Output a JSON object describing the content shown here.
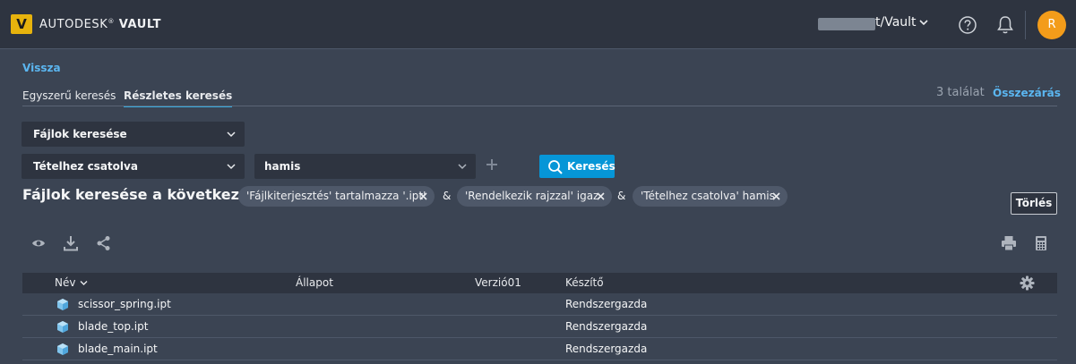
{
  "app": {
    "logo_letter": "V",
    "brand_prefix": "AUTODESK",
    "brand_product": "VAULT",
    "vault_name": "t/Vault",
    "user_initial": "R"
  },
  "nav": {
    "back_label": "Vissza"
  },
  "tabs": [
    {
      "label": "Egyszerű keresés",
      "active": false
    },
    {
      "label": "Részletes keresés",
      "active": true
    }
  ],
  "results": {
    "count_text": "3 találat",
    "collapse_label": "Összezárás"
  },
  "search": {
    "search_type": "Fájlok keresése",
    "property": "Tételhez csatolva",
    "value": "hamis",
    "button_label": "Keresés"
  },
  "criteria": {
    "label": "Fájlok keresése a következővel:",
    "chips": [
      "'Fájlkiterjesztés' tartalmazza '.ipt'",
      "'Rendelkezik rajzzal' igaz",
      "'Tételhez csatolva' hamis"
    ],
    "separator": "&",
    "clear_label": "Törlés"
  },
  "table": {
    "columns": [
      "Név",
      "Állapot",
      "Verzió01",
      "Készítő"
    ],
    "rows": [
      {
        "name": "scissor_spring.ipt",
        "state": "",
        "version": "",
        "author": "Rendszergazda"
      },
      {
        "name": "blade_top.ipt",
        "state": "",
        "version": "",
        "author": "Rendszergazda"
      },
      {
        "name": "blade_main.ipt",
        "state": "",
        "version": "",
        "author": "Rendszergazda"
      }
    ]
  },
  "colors": {
    "background": "#3b4453",
    "topbar": "#2e3440",
    "accent_link": "#5bb6f0",
    "primary_button": "#0696d7",
    "logo": "#e7b30d",
    "avatar": "#f39c1a"
  },
  "icons": {
    "toolbar_left": [
      "eye-icon",
      "download-icon",
      "share-icon"
    ],
    "toolbar_right": [
      "print-icon",
      "calculator-icon"
    ],
    "header": [
      "chevron-down-icon",
      "help-icon",
      "bell-icon"
    ]
  }
}
